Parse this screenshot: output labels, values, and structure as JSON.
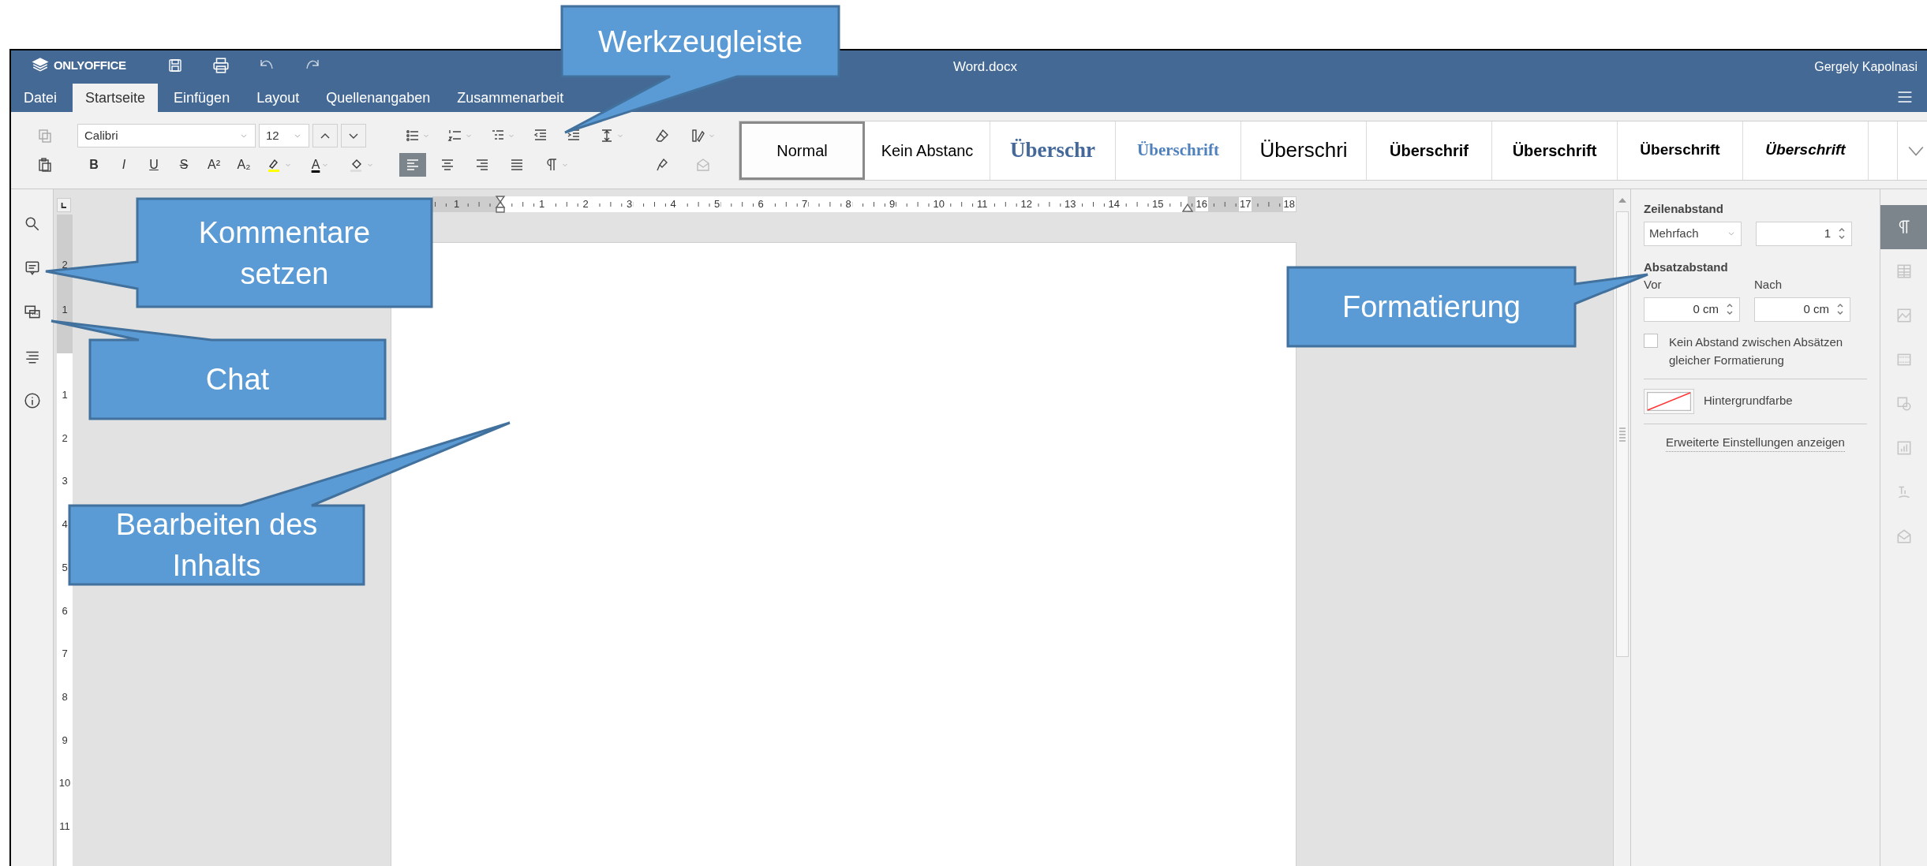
{
  "callouts": [
    {
      "text": "Werkzeugleiste"
    },
    {
      "text": "Kommentare setzen"
    },
    {
      "text": "Chat"
    },
    {
      "text": "Bearbeiten des Inhalts"
    },
    {
      "text": "Formatierung"
    }
  ],
  "header": {
    "logo": "ONLYOFFICE",
    "title": "Word.docx",
    "user": "Gergely Kapolnasi"
  },
  "tabs": [
    {
      "label": "Datei",
      "selected": false
    },
    {
      "label": "Startseite",
      "selected": true
    },
    {
      "label": "Einfügen",
      "selected": false
    },
    {
      "label": "Layout",
      "selected": false
    },
    {
      "label": "Quellenangaben",
      "selected": false
    },
    {
      "label": "Zusammenarbeit",
      "selected": false
    }
  ],
  "toolbar": {
    "font": "Calibri",
    "size": "12",
    "format_buttons": [
      {
        "label": "B",
        "kind": "bold"
      },
      {
        "label": "I",
        "kind": "italic"
      },
      {
        "label": "U",
        "kind": "underline"
      },
      {
        "label": "S",
        "kind": "strike"
      },
      {
        "label": "A²",
        "kind": "superscript"
      },
      {
        "label": "A₂",
        "kind": "subscript"
      }
    ],
    "font_color": "A",
    "align": [
      {
        "kind": "left",
        "selected": true
      },
      {
        "kind": "center",
        "selected": false
      },
      {
        "kind": "right",
        "selected": false
      },
      {
        "kind": "justify",
        "selected": false
      }
    ],
    "styles": [
      {
        "label": "Normal",
        "kind": "plain",
        "selected": true
      },
      {
        "label": "Kein Abstanc",
        "kind": "plain",
        "selected": false
      },
      {
        "label": "Überschr",
        "kind": "serif-large",
        "selected": false
      },
      {
        "label": "Überschrift",
        "kind": "serif",
        "selected": false
      },
      {
        "label": "Überschri",
        "kind": "sans-large",
        "selected": false
      },
      {
        "label": "Überschrif",
        "kind": "sans-bold",
        "selected": false
      },
      {
        "label": "Überschrift",
        "kind": "sans-bold",
        "selected": false
      },
      {
        "label": "Überschrift",
        "kind": "sans-bold-small",
        "selected": false
      },
      {
        "label": "Überschrift",
        "kind": "sans-bold-italic",
        "selected": false
      }
    ]
  },
  "ruler_horizontal": [
    "1",
    "1",
    "2",
    "3",
    "4",
    "5",
    "6",
    "7",
    "8",
    "9",
    "10",
    "11",
    "12",
    "13",
    "14",
    "15",
    "16",
    "17",
    "18"
  ],
  "ruler_vertical": [
    "2",
    "1",
    "1",
    "2",
    "3",
    "4",
    "5",
    "6",
    "7",
    "8",
    "9",
    "10",
    "11"
  ],
  "right_panel": {
    "line_spacing_label": "Zeilenabstand",
    "line_spacing_mode": "Mehrfach",
    "line_spacing_value": "1",
    "paragraph_spacing_label": "Absatzabstand",
    "before_label": "Vor",
    "before_value": "0 cm",
    "after_label": "Nach",
    "after_value": "0 cm",
    "no_spacing": {
      "label": "Kein Abstand zwischen Absätzen gleicher Formatierung",
      "checked": false
    },
    "background_label": "Hintergrundfarbe",
    "advanced_link": "Erweiterte Einstellungen anzeigen"
  },
  "right_tabs": [
    {
      "kind": "paragraph",
      "selected": true,
      "disabled": false
    },
    {
      "kind": "table",
      "selected": false,
      "disabled": true
    },
    {
      "kind": "image",
      "selected": false,
      "disabled": true
    },
    {
      "kind": "header",
      "selected": false,
      "disabled": true
    },
    {
      "kind": "shape",
      "selected": false,
      "disabled": true
    },
    {
      "kind": "chart",
      "selected": false,
      "disabled": true
    },
    {
      "kind": "textart",
      "selected": false,
      "disabled": true
    },
    {
      "kind": "mailmerge",
      "selected": false,
      "disabled": true
    }
  ]
}
